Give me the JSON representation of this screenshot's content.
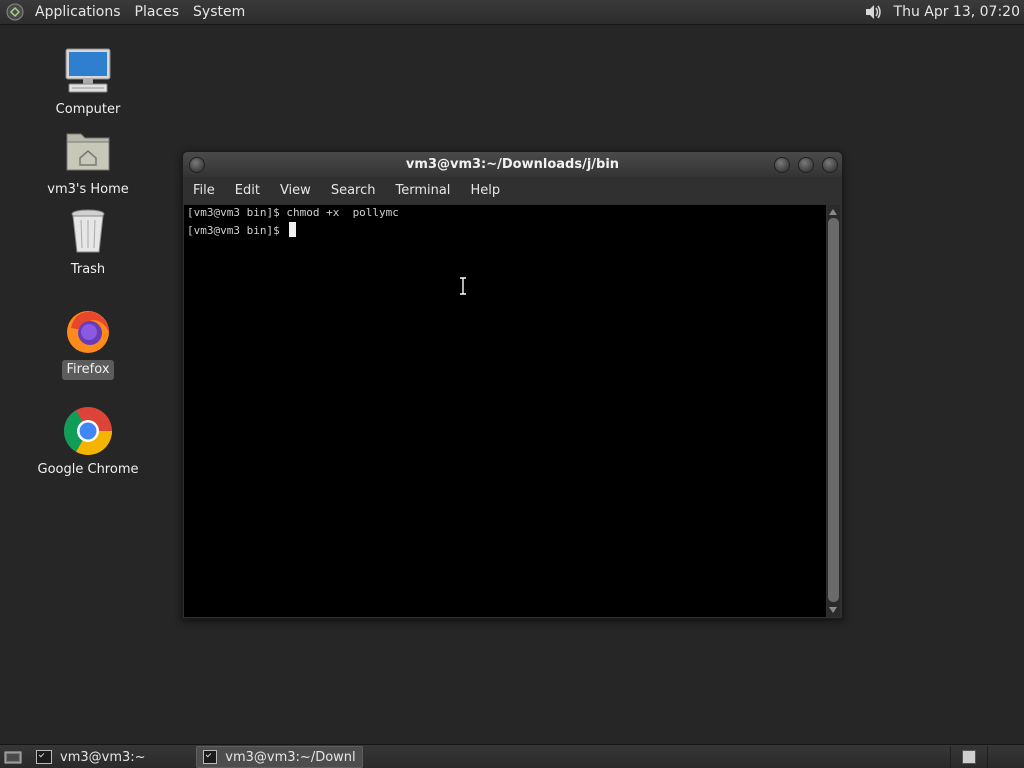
{
  "top_panel": {
    "menus": [
      "Applications",
      "Places",
      "System"
    ],
    "clock": "Thu Apr 13, 07:20"
  },
  "desktop": {
    "icons": [
      {
        "label": "Computer",
        "icon": "computer-icon"
      },
      {
        "label": "vm3's Home",
        "icon": "home-folder-icon"
      },
      {
        "label": "Trash",
        "icon": "trash-icon"
      },
      {
        "label": "Firefox",
        "icon": "firefox-icon",
        "selected": true
      },
      {
        "label": "Google Chrome",
        "icon": "chrome-icon"
      }
    ]
  },
  "terminal": {
    "title": "vm3@vm3:~/Downloads/j/bin",
    "menu": [
      "File",
      "Edit",
      "View",
      "Search",
      "Terminal",
      "Help"
    ],
    "lines": [
      "[vm3@vm3 bin]$ chmod +x  pollymc",
      "[vm3@vm3 bin]$ "
    ]
  },
  "bottom_panel": {
    "tasks": [
      {
        "label": "vm3@vm3:~",
        "active": false
      },
      {
        "label": "vm3@vm3:~/Downl...",
        "active": true
      }
    ]
  },
  "colors": {
    "desktop_bg": "#262626",
    "panel_bg": "#303030",
    "terminal_bg": "#000000",
    "terminal_fg": "#d0d0d0"
  }
}
